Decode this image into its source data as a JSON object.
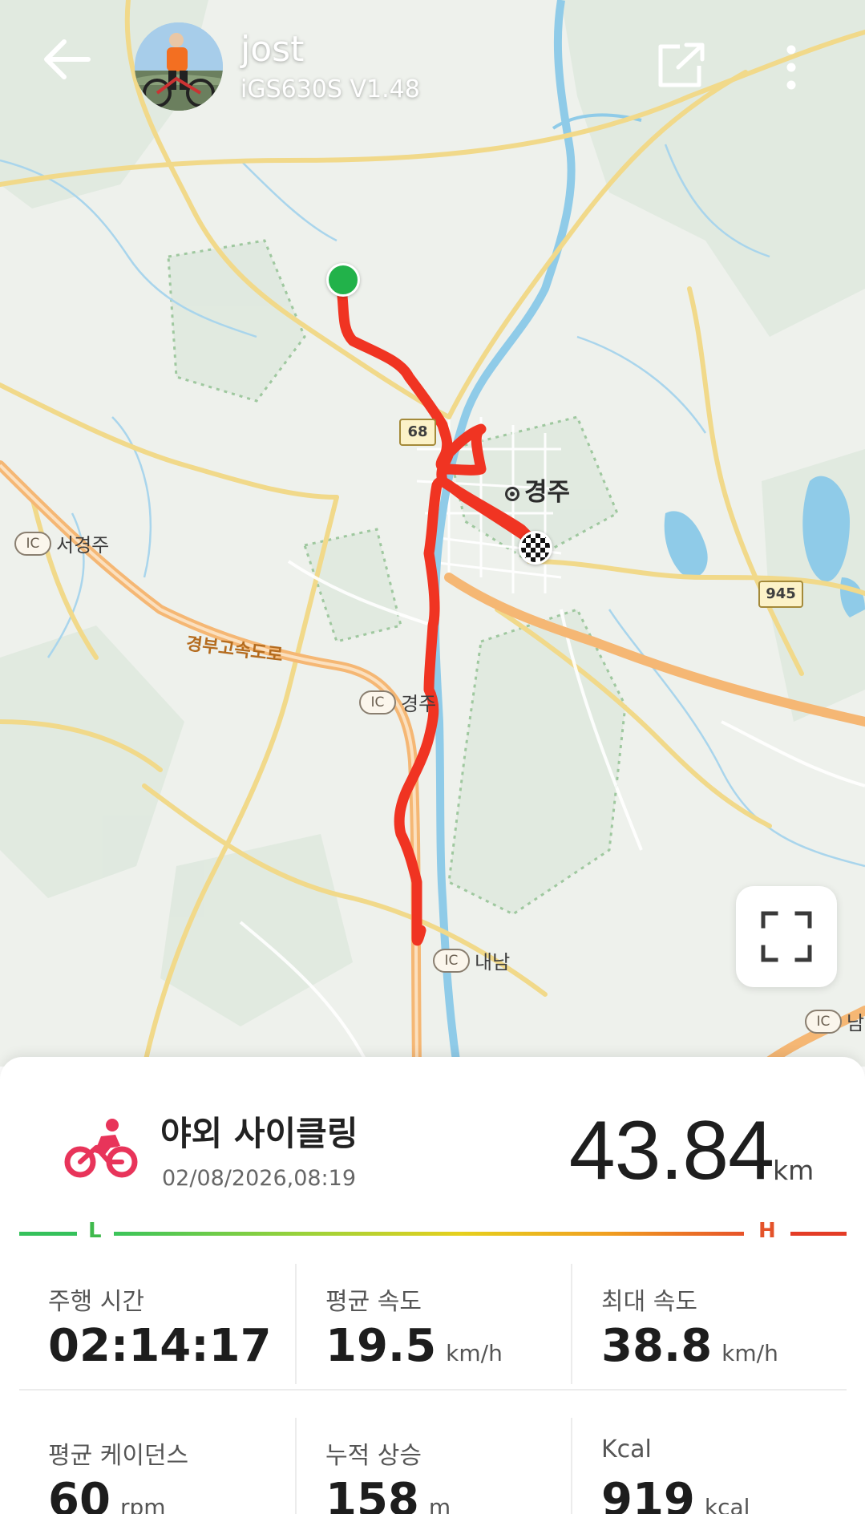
{
  "header": {
    "user_name": "jost",
    "device": "iGS630S  V1.48",
    "icons": {
      "back": "arrow-left-icon",
      "share": "share-external-icon",
      "more": "more-vertical-icon"
    }
  },
  "map": {
    "city_label": "경주",
    "ic_labels": {
      "west": "서경주",
      "center": "경주",
      "south": "내남",
      "east": "남"
    },
    "ic_badge": "IC",
    "highway_name": "경부고속도로",
    "route_shields": {
      "r68": "68",
      "r945": "945"
    },
    "colors": {
      "track": "#f03422",
      "start_marker": "#22b24a",
      "water": "#8fcbe8",
      "road": "#f4dc8c",
      "highway": "#f5b774"
    },
    "fullscreen_icon": "fullscreen-icon"
  },
  "activity": {
    "type_icon": "bicycle-icon",
    "title": "야외 사이클링",
    "datetime": "02/08/2026,08:19",
    "distance": "43.84",
    "distance_unit": "km",
    "intensity": {
      "low": "L",
      "high": "H"
    },
    "stats": [
      {
        "label": "주행 시간",
        "value": "02:14:17",
        "unit": ""
      },
      {
        "label": "평균 속도",
        "value": "19.5",
        "unit": "km/h"
      },
      {
        "label": "최대 속도",
        "value": "38.8",
        "unit": "km/h"
      },
      {
        "label": "평균 케이던스",
        "value": "60",
        "unit": "rpm"
      },
      {
        "label": "누적 상승",
        "value": "158",
        "unit": "m"
      },
      {
        "label": "Kcal",
        "value": "919",
        "unit": "kcal"
      }
    ],
    "accent_color": "#e8345a"
  }
}
